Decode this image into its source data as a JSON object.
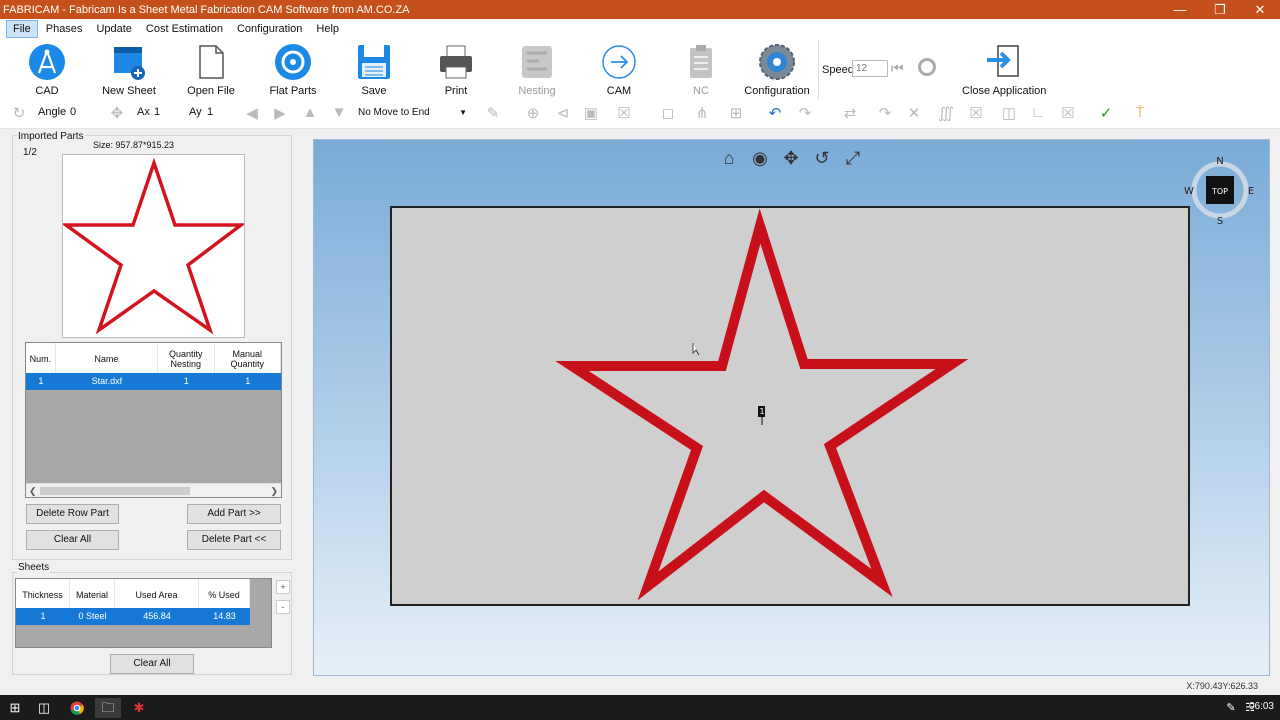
{
  "window": {
    "title": "FABRICAM - Fabricam Is a Sheet Metal Fabrication CAM Software from AM.CO.ZA"
  },
  "menu": [
    "File",
    "Phases",
    "Update",
    "Cost Estimation",
    "Configuration",
    "Help"
  ],
  "ribbon": {
    "cad": "CAD",
    "new_sheet": "New Sheet",
    "open_file": "Open File",
    "flat_parts": "Flat Parts",
    "save": "Save",
    "print": "Print",
    "nesting": "Nesting",
    "cam": "CAM",
    "nc": "NC",
    "configuration": "Configuration",
    "speed_label": "Speed",
    "speed_value": "12",
    "close_app": "Close Application"
  },
  "toolbar2": {
    "angle_label": "Angle",
    "angle_value": "0",
    "ax_label": "Ax",
    "ax_value": "1",
    "ay_label": "Ay",
    "ay_value": "1",
    "move_mode": "No Move to End"
  },
  "imported_parts": {
    "label": "Imported Parts",
    "page": "1/2",
    "size": "Size: 957.87*915.23",
    "columns": [
      "Num.",
      "Name",
      "Quantity Nesting",
      "Manual Quantity"
    ],
    "rows": [
      {
        "num": "1",
        "name": "Star.dxf",
        "qty_nesting": "1",
        "manual_qty": "1"
      }
    ],
    "buttons": {
      "delete_row": "Delete Row Part",
      "add_part": "Add Part >>",
      "clear_all": "Clear All",
      "delete_part": "Delete Part <<"
    }
  },
  "sheets": {
    "label": "Sheets",
    "columns": [
      "Thickness",
      "Material",
      "Used Area",
      "% Used"
    ],
    "rows": [
      {
        "thickness": "1",
        "material": "0  Steel",
        "used_area": "456.84",
        "pct_used": "14.83"
      }
    ],
    "plus": "+",
    "minus": "-",
    "clear_all": "Clear All"
  },
  "viewport": {
    "part_number": "1",
    "compass": {
      "n": "N",
      "s": "S",
      "e": "E",
      "w": "W",
      "center": "TOP"
    }
  },
  "status": {
    "coords": "X:790.43Y:626.33"
  },
  "taskbar": {
    "time": "06:03"
  },
  "colors": {
    "accent": "#c6501b",
    "selection": "#1779d6",
    "part_outline": "#c8101b",
    "sheet": "#cfcfcf"
  },
  "icons": [
    "cad-icon",
    "new-sheet-icon",
    "open-file-icon",
    "flat-parts-icon",
    "save-icon",
    "print-icon",
    "nesting-icon",
    "cam-icon",
    "nc-icon",
    "configuration-icon",
    "close-application-icon",
    "home-icon",
    "orbit-icon",
    "pan-icon",
    "rotate-icon",
    "zoom-fit-icon",
    "undo-icon",
    "redo-icon"
  ]
}
